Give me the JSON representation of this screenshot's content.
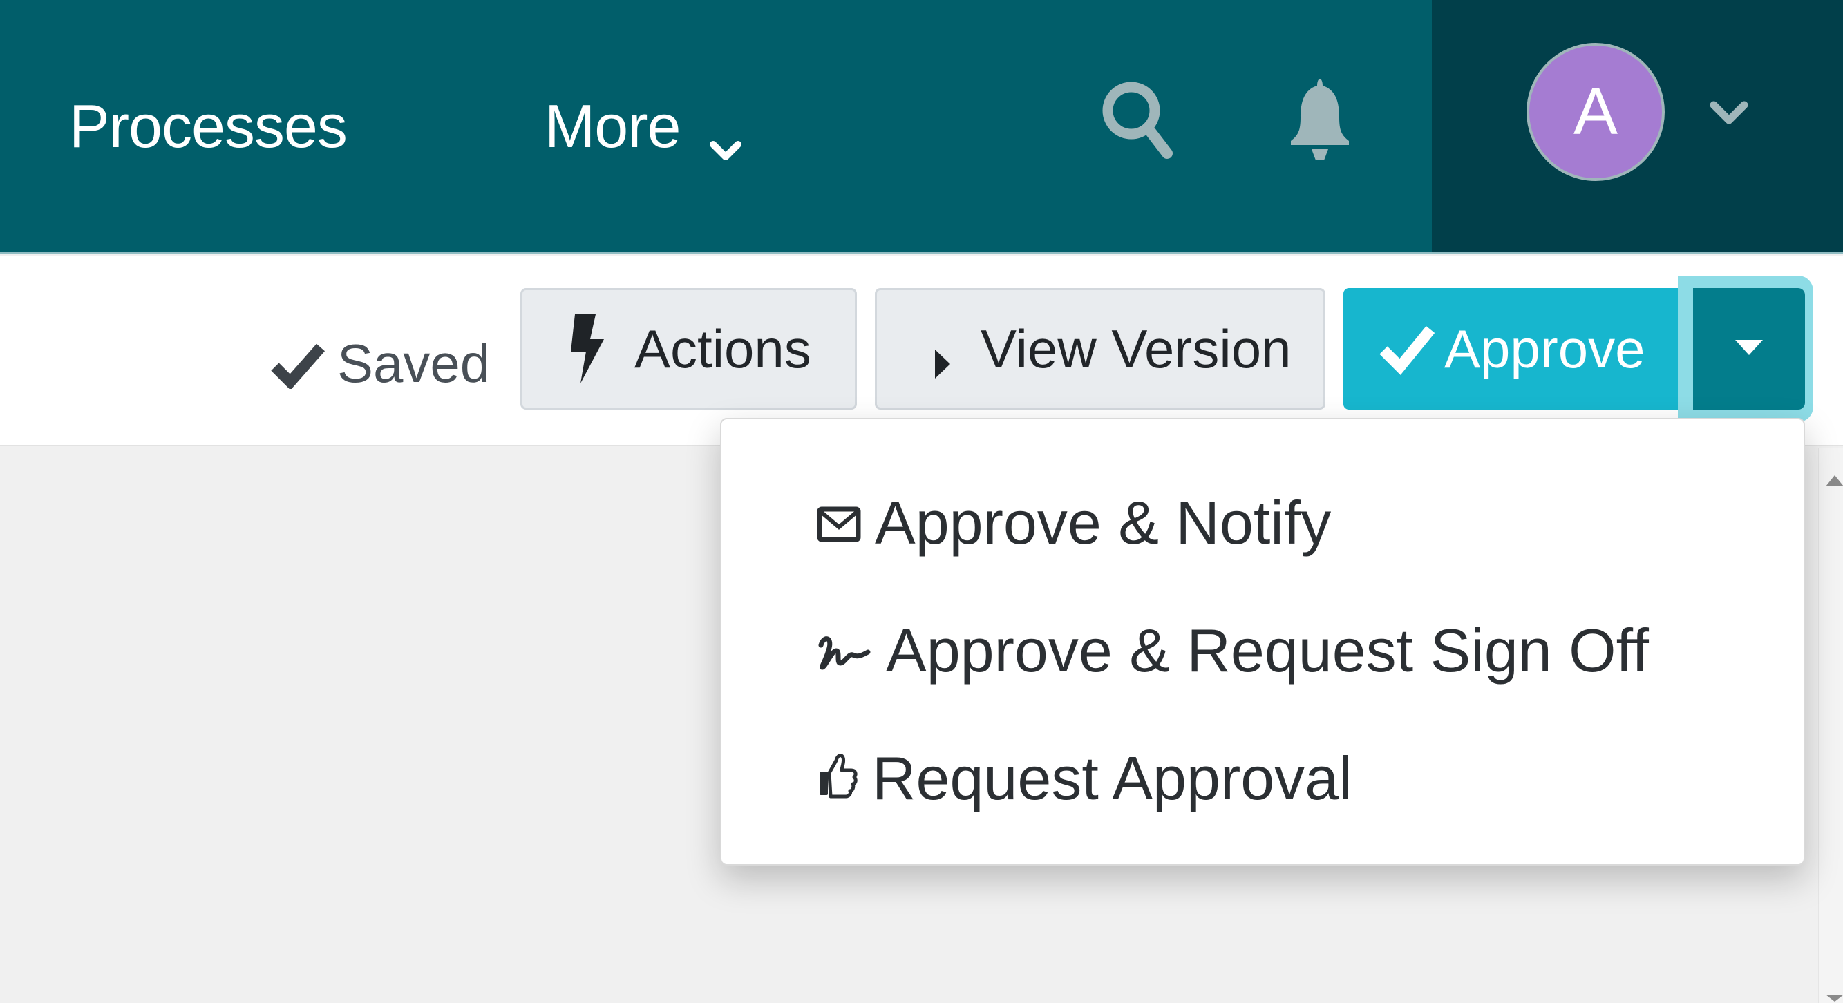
{
  "nav": {
    "items": [
      {
        "label": "Processes"
      },
      {
        "label": "More"
      }
    ],
    "search_icon": "search-icon",
    "notifications_icon": "bell-icon",
    "user": {
      "initial": "A",
      "avatar_color": "#a57cd2",
      "menu_icon": "chevron-down-icon"
    },
    "colors": {
      "nav_bg": "#015e6a",
      "user_zone_bg": "#013f4a"
    }
  },
  "toolbar": {
    "status": {
      "label": "Saved",
      "icon": "check-icon"
    },
    "actions_label": "Actions",
    "actions_icon": "bolt-icon",
    "view_version_label": "View Version",
    "view_version_icon": "caret-right-icon",
    "approve_label": "Approve",
    "approve_icon": "check-icon",
    "approve_toggle_icon": "caret-down-icon",
    "colors": {
      "approve": "#17b6ce",
      "approve_toggle": "#037d8c"
    }
  },
  "approve_menu": {
    "open": true,
    "items": [
      {
        "label": "Approve & Notify",
        "icon": "envelope-icon"
      },
      {
        "label": "Approve & Request Sign Off",
        "icon": "signature-icon"
      },
      {
        "label": "Request Approval",
        "icon": "thumbs-up-icon"
      }
    ]
  }
}
